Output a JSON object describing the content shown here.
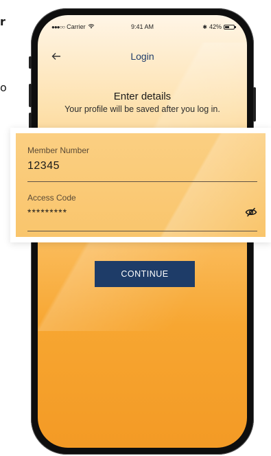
{
  "side_text": {
    "line1": "r",
    "line2": "o"
  },
  "status_bar": {
    "carrier": "Carrier",
    "time": "9:41 AM",
    "battery": "42%"
  },
  "nav": {
    "title": "Login"
  },
  "header": {
    "title": "Enter details",
    "subtitle": "Your profile will be saved after you log in."
  },
  "form": {
    "member_number": {
      "label": "Member Number",
      "value": "12345"
    },
    "access_code": {
      "label": "Access Code",
      "value": "*********"
    }
  },
  "actions": {
    "continue_label": "CONTINUE"
  },
  "colors": {
    "button": "#1e3c68",
    "gradient_top": "#fff5e6",
    "gradient_bottom": "#f39a25"
  }
}
